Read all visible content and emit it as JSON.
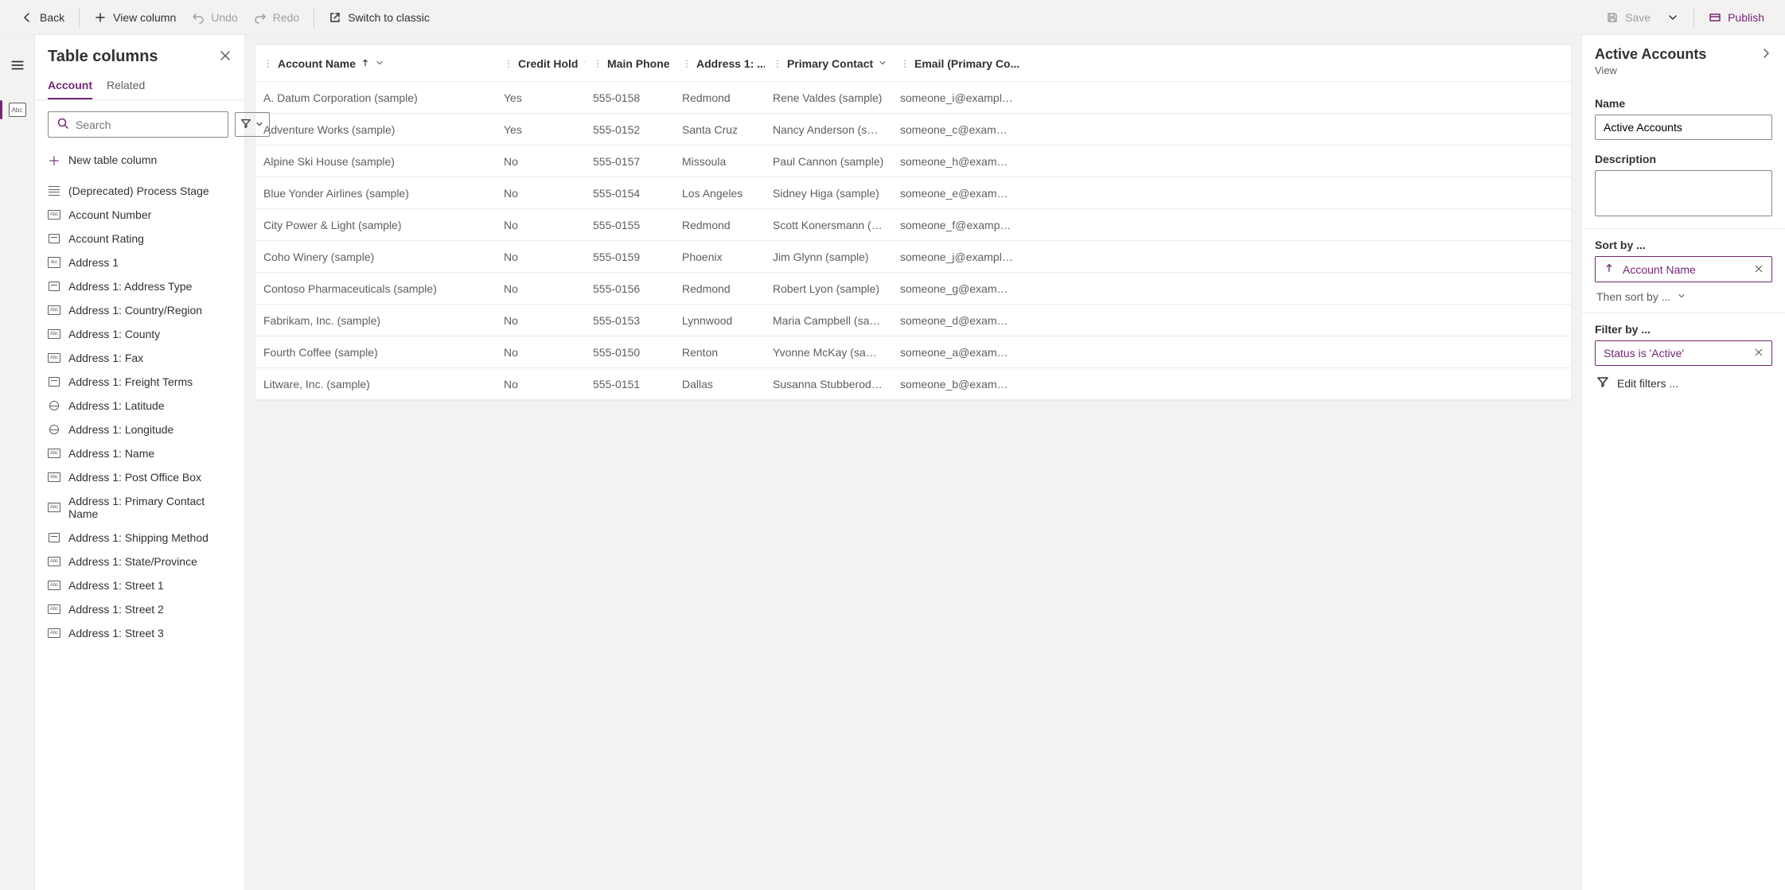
{
  "toolbar": {
    "back": "Back",
    "view_column": "View column",
    "undo": "Undo",
    "redo": "Redo",
    "switch": "Switch to classic",
    "save": "Save",
    "publish": "Publish"
  },
  "left_panel": {
    "title": "Table columns",
    "tabs": {
      "account": "Account",
      "related": "Related"
    },
    "search_placeholder": "Search",
    "new_column": "New table column",
    "items": [
      {
        "label": "(Deprecated) Process Stage",
        "type": "lines"
      },
      {
        "label": "Account Number",
        "type": "abc"
      },
      {
        "label": "Account Rating",
        "type": "card"
      },
      {
        "label": "Address 1",
        "type": "abc2"
      },
      {
        "label": "Address 1: Address Type",
        "type": "card"
      },
      {
        "label": "Address 1: Country/Region",
        "type": "abc"
      },
      {
        "label": "Address 1: County",
        "type": "abc"
      },
      {
        "label": "Address 1: Fax",
        "type": "abc"
      },
      {
        "label": "Address 1: Freight Terms",
        "type": "card"
      },
      {
        "label": "Address 1: Latitude",
        "type": "globe"
      },
      {
        "label": "Address 1: Longitude",
        "type": "globe"
      },
      {
        "label": "Address 1: Name",
        "type": "abc"
      },
      {
        "label": "Address 1: Post Office Box",
        "type": "abc"
      },
      {
        "label": "Address 1: Primary Contact Name",
        "type": "abc"
      },
      {
        "label": "Address 1: Shipping Method",
        "type": "card"
      },
      {
        "label": "Address 1: State/Province",
        "type": "abc"
      },
      {
        "label": "Address 1: Street 1",
        "type": "abc"
      },
      {
        "label": "Address 1: Street 2",
        "type": "abc"
      },
      {
        "label": "Address 1: Street 3",
        "type": "abc"
      }
    ]
  },
  "grid": {
    "columns": {
      "name": "Account Name",
      "credit": "Credit Hold",
      "phone": "Main Phone",
      "addr": "Address 1: ...",
      "contact": "Primary Contact",
      "email": "Email (Primary Co..."
    },
    "rows": [
      {
        "name": "A. Datum Corporation (sample)",
        "credit": "Yes",
        "phone": "555-0158",
        "addr": "Redmond",
        "contact": "Rene Valdes (sample)",
        "email": "someone_i@example.com"
      },
      {
        "name": "Adventure Works (sample)",
        "credit": "Yes",
        "phone": "555-0152",
        "addr": "Santa Cruz",
        "contact": "Nancy Anderson (sample)",
        "email": "someone_c@example.com"
      },
      {
        "name": "Alpine Ski House (sample)",
        "credit": "No",
        "phone": "555-0157",
        "addr": "Missoula",
        "contact": "Paul Cannon (sample)",
        "email": "someone_h@example.com"
      },
      {
        "name": "Blue Yonder Airlines (sample)",
        "credit": "No",
        "phone": "555-0154",
        "addr": "Los Angeles",
        "contact": "Sidney Higa (sample)",
        "email": "someone_e@example.com"
      },
      {
        "name": "City Power & Light (sample)",
        "credit": "No",
        "phone": "555-0155",
        "addr": "Redmond",
        "contact": "Scott Konersmann (sample)",
        "email": "someone_f@example.com"
      },
      {
        "name": "Coho Winery (sample)",
        "credit": "No",
        "phone": "555-0159",
        "addr": "Phoenix",
        "contact": "Jim Glynn (sample)",
        "email": "someone_j@example.com"
      },
      {
        "name": "Contoso Pharmaceuticals (sample)",
        "credit": "No",
        "phone": "555-0156",
        "addr": "Redmond",
        "contact": "Robert Lyon (sample)",
        "email": "someone_g@example.com"
      },
      {
        "name": "Fabrikam, Inc. (sample)",
        "credit": "No",
        "phone": "555-0153",
        "addr": "Lynnwood",
        "contact": "Maria Campbell (sample)",
        "email": "someone_d@example.com"
      },
      {
        "name": "Fourth Coffee (sample)",
        "credit": "No",
        "phone": "555-0150",
        "addr": "Renton",
        "contact": "Yvonne McKay (sample)",
        "email": "someone_a@example.com"
      },
      {
        "name": "Litware, Inc. (sample)",
        "credit": "No",
        "phone": "555-0151",
        "addr": "Dallas",
        "contact": "Susanna Stubberod (sampl...",
        "email": "someone_b@example.com"
      }
    ]
  },
  "right_panel": {
    "title": "Active Accounts",
    "subtitle": "View",
    "name_label": "Name",
    "name_value": "Active Accounts",
    "description_label": "Description",
    "sort_label": "Sort by ...",
    "sort_chip": "Account Name",
    "then_sort": "Then sort by ...",
    "filter_label": "Filter by ...",
    "filter_chip": "Status is 'Active'",
    "edit_filters": "Edit filters ..."
  }
}
